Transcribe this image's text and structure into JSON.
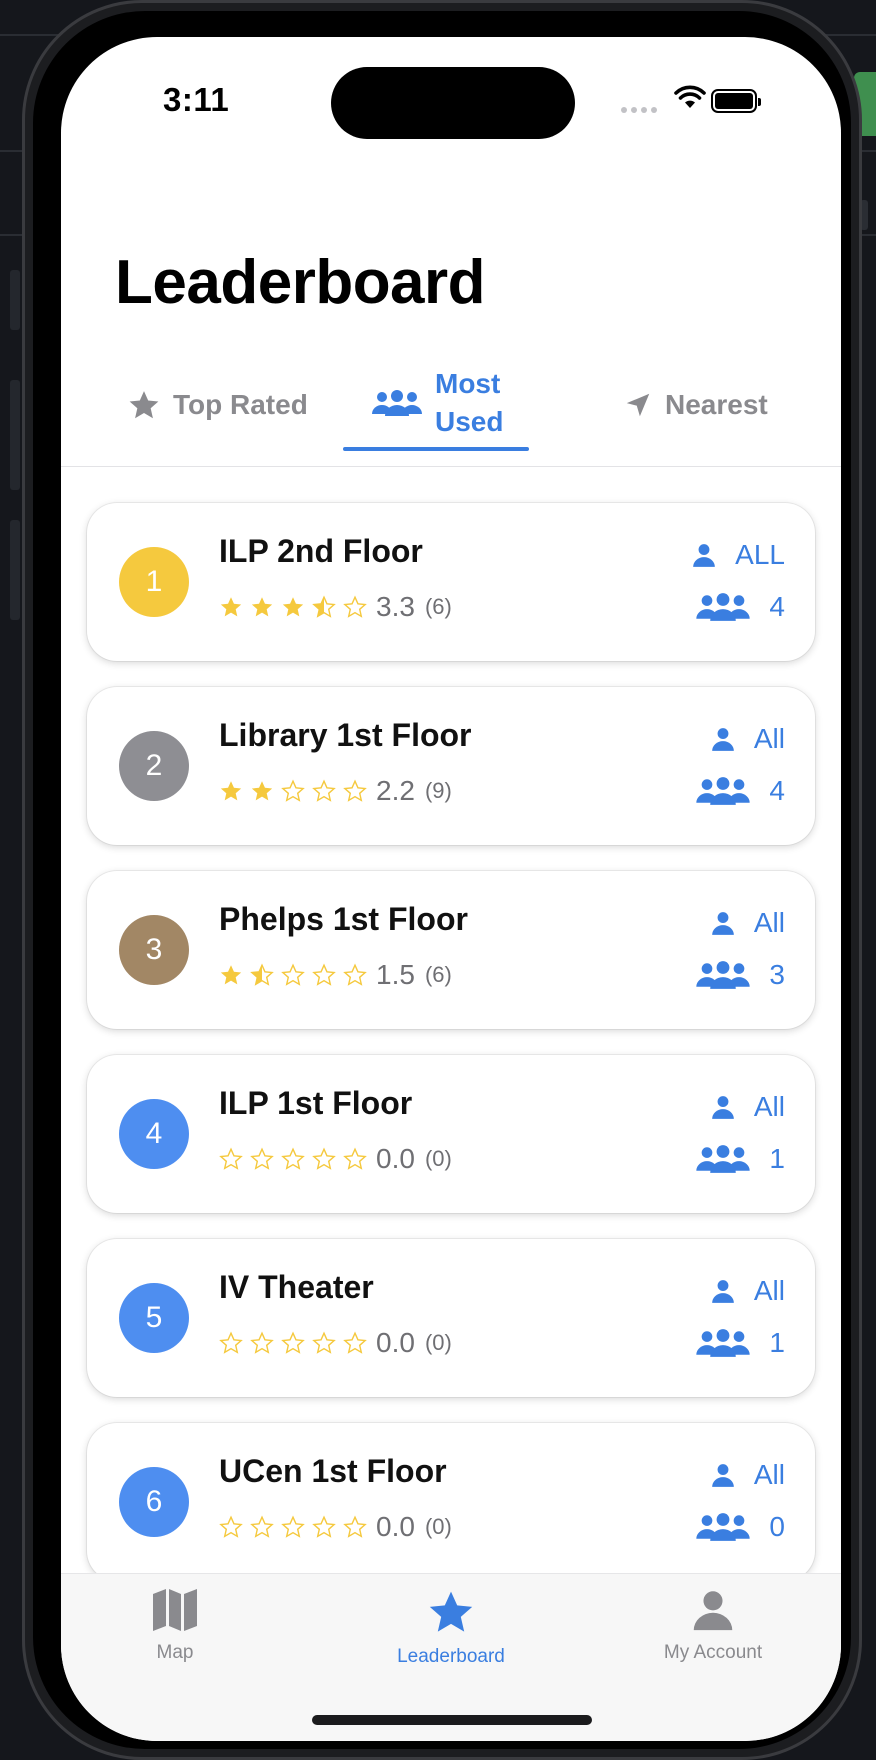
{
  "status_bar": {
    "time": "3:11"
  },
  "page": {
    "title": "Leaderboard"
  },
  "tabs": [
    {
      "label": "Top Rated",
      "icon": "star-icon",
      "selected": false
    },
    {
      "label": "Most Used",
      "label_line1": "Most",
      "label_line2": "Used",
      "icon": "people-icon",
      "selected": true
    },
    {
      "label": "Nearest",
      "icon": "location-arrow-icon",
      "selected": false
    }
  ],
  "spots": [
    {
      "rank": "1",
      "name": "ILP 2nd Floor",
      "rating": 3.3,
      "rating_text": "3.3",
      "reviews": "(6)",
      "access": "ALL",
      "group_count": "4",
      "rank_color": "#f5c93e"
    },
    {
      "rank": "2",
      "name": "Library 1st Floor",
      "rating": 2.2,
      "rating_text": "2.2",
      "reviews": "(9)",
      "access": "All",
      "group_count": "4",
      "rank_color": "#8e8e93"
    },
    {
      "rank": "3",
      "name": "Phelps 1st Floor",
      "rating": 1.5,
      "rating_text": "1.5",
      "reviews": "(6)",
      "access": "All",
      "group_count": "3",
      "rank_color": "#a28765"
    },
    {
      "rank": "4",
      "name": "ILP 1st Floor",
      "rating": 0.0,
      "rating_text": "0.0",
      "reviews": "(0)",
      "access": "All",
      "group_count": "1",
      "rank_color": "#4e8ef0"
    },
    {
      "rank": "5",
      "name": "IV Theater",
      "rating": 0.0,
      "rating_text": "0.0",
      "reviews": "(0)",
      "access": "All",
      "group_count": "1",
      "rank_color": "#4e8ef0"
    },
    {
      "rank": "6",
      "name": "UCen 1st Floor",
      "rating": 0.0,
      "rating_text": "0.0",
      "reviews": "(0)",
      "access": "All",
      "group_count": "0",
      "rank_color": "#4e8ef0"
    }
  ],
  "tabbar": [
    {
      "label": "Map",
      "icon": "map-icon",
      "active": false
    },
    {
      "label": "Leaderboard",
      "icon": "star-icon",
      "active": true
    },
    {
      "label": "My Account",
      "icon": "person-icon",
      "active": false
    }
  ],
  "colors": {
    "accent": "#3a7ee0",
    "star": "#f5c93e",
    "inactive": "#8a8a8e"
  }
}
